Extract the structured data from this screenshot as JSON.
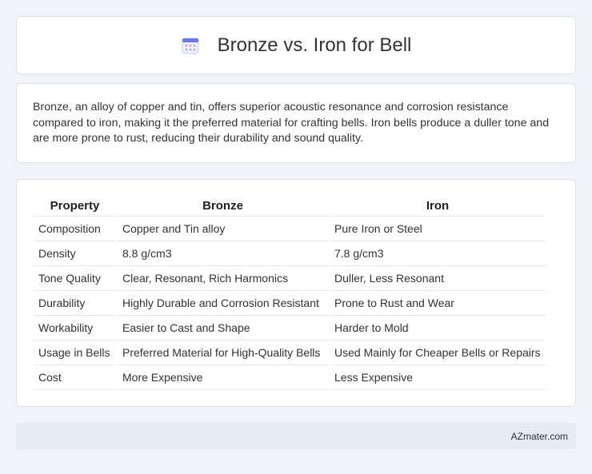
{
  "header": {
    "title": "Bronze vs. Iron for Bell",
    "icon": "calendar-icon"
  },
  "description": "Bronze, an alloy of copper and tin, offers superior acoustic resonance and corrosion resistance compared to iron, making it the preferred material for crafting bells. Iron bells produce a duller tone and are more prone to rust, reducing their durability and sound quality.",
  "table": {
    "headers": [
      "Property",
      "Bronze",
      "Iron"
    ],
    "rows": [
      [
        "Composition",
        "Copper and Tin alloy",
        "Pure Iron or Steel"
      ],
      [
        "Density",
        "8.8 g/cm3",
        "7.8 g/cm3"
      ],
      [
        "Tone Quality",
        "Clear, Resonant, Rich Harmonics",
        "Duller, Less Resonant"
      ],
      [
        "Durability",
        "Highly Durable and Corrosion Resistant",
        "Prone to Rust and Wear"
      ],
      [
        "Workability",
        "Easier to Cast and Shape",
        "Harder to Mold"
      ],
      [
        "Usage in Bells",
        "Preferred Material for High-Quality Bells",
        "Used Mainly for Cheaper Bells or Repairs"
      ],
      [
        "Cost",
        "More Expensive",
        "Less Expensive"
      ]
    ]
  },
  "footer": {
    "brand": "AZmater.com"
  }
}
